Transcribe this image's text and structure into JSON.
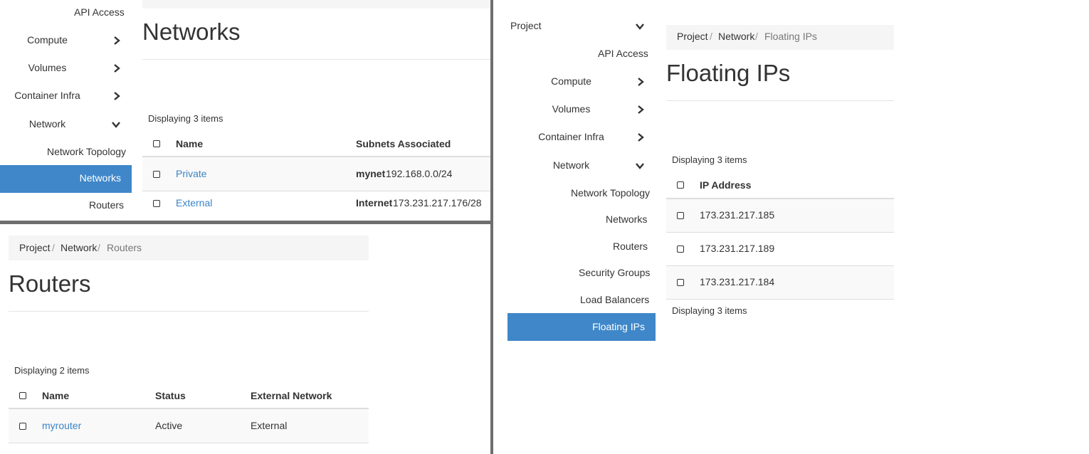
{
  "networks_panel": {
    "sidebar": {
      "api_access": "API Access",
      "compute": "Compute",
      "volumes": "Volumes",
      "container_infra": "Container Infra",
      "network": "Network",
      "network_topology": "Network Topology",
      "networks": "Networks",
      "routers": "Routers"
    },
    "title": "Networks",
    "count": "Displaying 3 items",
    "columns": {
      "name": "Name",
      "subnets": "Subnets Associated"
    },
    "rows": [
      {
        "name": "Private",
        "subnet_name": "mynet",
        "subnet_cidr": "192.168.0.0/24"
      },
      {
        "name": "External",
        "subnet_name": "Internet",
        "subnet_cidr": "173.231.217.176/28"
      }
    ]
  },
  "routers_panel": {
    "breadcrumb": {
      "project": "Project",
      "network": "Network",
      "current": "Routers",
      "sep": "/"
    },
    "title": "Routers",
    "count": "Displaying 2 items",
    "columns": {
      "name": "Name",
      "status": "Status",
      "external_network": "External Network"
    },
    "rows": [
      {
        "name": "myrouter",
        "status": "Active",
        "external_network": "External"
      }
    ]
  },
  "floating_panel": {
    "sidebar": {
      "project": "Project",
      "api_access": "API Access",
      "compute": "Compute",
      "volumes": "Volumes",
      "container_infra": "Container Infra",
      "network": "Network",
      "network_topology": "Network Topology",
      "networks": "Networks",
      "routers": "Routers",
      "security_groups": "Security Groups",
      "load_balancers": "Load Balancers",
      "floating_ips": "Floating IPs"
    },
    "breadcrumb": {
      "project": "Project",
      "network": "Network",
      "current": "Floating IPs",
      "sep": "/"
    },
    "title": "Floating IPs",
    "count_top": "Displaying 3 items",
    "count_bottom": "Displaying 3 items",
    "columns": {
      "ip_address": "IP Address"
    },
    "rows": [
      {
        "ip": "173.231.217.185"
      },
      {
        "ip": "173.231.217.189"
      },
      {
        "ip": "173.231.217.184"
      }
    ]
  },
  "colors": {
    "accent": "#3f87c9",
    "link": "#3b84c5",
    "divider": "#6e6e6e"
  }
}
